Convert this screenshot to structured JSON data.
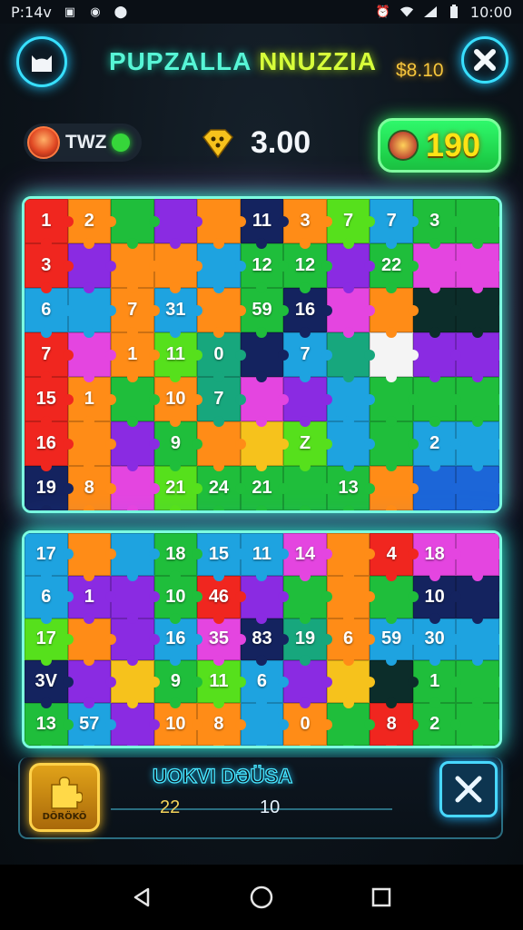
{
  "status_bar": {
    "left_text": "P:14v",
    "time": "10:00"
  },
  "header": {
    "title_part1": "PUPZALLA ",
    "title_part2": "NNUZZIA",
    "money": "$8.10"
  },
  "hud": {
    "player_name": "TWZ",
    "score": "3.00",
    "coins": "190"
  },
  "colors": {
    "red": "#f0261f",
    "orange": "#ff8c17",
    "yellow": "#f6c21c",
    "lime": "#56e01c",
    "green": "#1fbe3b",
    "teal": "#17a77d",
    "cyan": "#1ea3e0",
    "blue": "#1c66d8",
    "navy": "#14235f",
    "purple": "#8a2be2",
    "magenta": "#e445e0",
    "white": "#f4f4f4",
    "dark": "#0c2d2a"
  },
  "board_top": {
    "tiles": [
      {
        "c": "red",
        "n": "1"
      },
      {
        "c": "orange",
        "n": "2"
      },
      {
        "c": "green",
        "n": ""
      },
      {
        "c": "purple",
        "n": ""
      },
      {
        "c": "orange",
        "n": ""
      },
      {
        "c": "navy",
        "n": "11"
      },
      {
        "c": "orange",
        "n": "3"
      },
      {
        "c": "lime",
        "n": "7"
      },
      {
        "c": "cyan",
        "n": "7"
      },
      {
        "c": "green",
        "n": "3"
      },
      {
        "c": "green",
        "n": ""
      },
      {
        "c": "red",
        "n": "3"
      },
      {
        "c": "purple",
        "n": ""
      },
      {
        "c": "orange",
        "n": ""
      },
      {
        "c": "orange",
        "n": ""
      },
      {
        "c": "cyan",
        "n": ""
      },
      {
        "c": "green",
        "n": "12"
      },
      {
        "c": "green",
        "n": "12"
      },
      {
        "c": "purple",
        "n": ""
      },
      {
        "c": "green",
        "n": "22"
      },
      {
        "c": "magenta",
        "n": ""
      },
      {
        "c": "magenta",
        "n": ""
      },
      {
        "c": "cyan",
        "n": "6"
      },
      {
        "c": "cyan",
        "n": ""
      },
      {
        "c": "orange",
        "n": "7"
      },
      {
        "c": "cyan",
        "n": "31"
      },
      {
        "c": "orange",
        "n": ""
      },
      {
        "c": "green",
        "n": "59"
      },
      {
        "c": "navy",
        "n": "16"
      },
      {
        "c": "magenta",
        "n": ""
      },
      {
        "c": "orange",
        "n": ""
      },
      {
        "c": "dark",
        "n": ""
      },
      {
        "c": "dark",
        "n": ""
      },
      {
        "c": "red",
        "n": "7"
      },
      {
        "c": "magenta",
        "n": ""
      },
      {
        "c": "orange",
        "n": "1"
      },
      {
        "c": "lime",
        "n": "11"
      },
      {
        "c": "teal",
        "n": "0"
      },
      {
        "c": "navy",
        "n": ""
      },
      {
        "c": "cyan",
        "n": "7"
      },
      {
        "c": "teal",
        "n": ""
      },
      {
        "c": "white",
        "n": ""
      },
      {
        "c": "purple",
        "n": ""
      },
      {
        "c": "purple",
        "n": ""
      },
      {
        "c": "red",
        "n": "15"
      },
      {
        "c": "orange",
        "n": "1"
      },
      {
        "c": "green",
        "n": ""
      },
      {
        "c": "orange",
        "n": "10"
      },
      {
        "c": "teal",
        "n": "7"
      },
      {
        "c": "magenta",
        "n": ""
      },
      {
        "c": "purple",
        "n": ""
      },
      {
        "c": "cyan",
        "n": ""
      },
      {
        "c": "green",
        "n": ""
      },
      {
        "c": "green",
        "n": ""
      },
      {
        "c": "green",
        "n": ""
      },
      {
        "c": "red",
        "n": "16"
      },
      {
        "c": "orange",
        "n": ""
      },
      {
        "c": "purple",
        "n": ""
      },
      {
        "c": "green",
        "n": "9"
      },
      {
        "c": "orange",
        "n": ""
      },
      {
        "c": "yellow",
        "n": ""
      },
      {
        "c": "lime",
        "n": "Z"
      },
      {
        "c": "cyan",
        "n": ""
      },
      {
        "c": "green",
        "n": ""
      },
      {
        "c": "cyan",
        "n": "2"
      },
      {
        "c": "cyan",
        "n": ""
      },
      {
        "c": "navy",
        "n": "19"
      },
      {
        "c": "orange",
        "n": "8"
      },
      {
        "c": "magenta",
        "n": ""
      },
      {
        "c": "lime",
        "n": "21"
      },
      {
        "c": "green",
        "n": "24"
      },
      {
        "c": "green",
        "n": "21"
      },
      {
        "c": "green",
        "n": ""
      },
      {
        "c": "green",
        "n": "13"
      },
      {
        "c": "orange",
        "n": ""
      },
      {
        "c": "blue",
        "n": ""
      },
      {
        "c": "blue",
        "n": ""
      }
    ]
  },
  "board_bottom": {
    "tiles": [
      {
        "c": "cyan",
        "n": "17"
      },
      {
        "c": "orange",
        "n": ""
      },
      {
        "c": "cyan",
        "n": ""
      },
      {
        "c": "green",
        "n": "18"
      },
      {
        "c": "cyan",
        "n": "15"
      },
      {
        "c": "cyan",
        "n": "11"
      },
      {
        "c": "magenta",
        "n": "14"
      },
      {
        "c": "orange",
        "n": ""
      },
      {
        "c": "red",
        "n": "4"
      },
      {
        "c": "magenta",
        "n": "18"
      },
      {
        "c": "magenta",
        "n": ""
      },
      {
        "c": "cyan",
        "n": "6"
      },
      {
        "c": "purple",
        "n": "1"
      },
      {
        "c": "purple",
        "n": ""
      },
      {
        "c": "green",
        "n": "10"
      },
      {
        "c": "red",
        "n": "46"
      },
      {
        "c": "purple",
        "n": ""
      },
      {
        "c": "green",
        "n": ""
      },
      {
        "c": "orange",
        "n": ""
      },
      {
        "c": "green",
        "n": ""
      },
      {
        "c": "navy",
        "n": "10"
      },
      {
        "c": "navy",
        "n": ""
      },
      {
        "c": "lime",
        "n": "17"
      },
      {
        "c": "orange",
        "n": ""
      },
      {
        "c": "purple",
        "n": ""
      },
      {
        "c": "cyan",
        "n": "16"
      },
      {
        "c": "magenta",
        "n": "35"
      },
      {
        "c": "navy",
        "n": "83"
      },
      {
        "c": "teal",
        "n": "19"
      },
      {
        "c": "orange",
        "n": "6"
      },
      {
        "c": "cyan",
        "n": "59"
      },
      {
        "c": "cyan",
        "n": "30"
      },
      {
        "c": "cyan",
        "n": ""
      },
      {
        "c": "navy",
        "n": "3V"
      },
      {
        "c": "purple",
        "n": ""
      },
      {
        "c": "yellow",
        "n": ""
      },
      {
        "c": "green",
        "n": "9"
      },
      {
        "c": "lime",
        "n": "11"
      },
      {
        "c": "cyan",
        "n": "6"
      },
      {
        "c": "purple",
        "n": ""
      },
      {
        "c": "yellow",
        "n": ""
      },
      {
        "c": "dark",
        "n": ""
      },
      {
        "c": "green",
        "n": "1"
      },
      {
        "c": "green",
        "n": ""
      },
      {
        "c": "green",
        "n": "13"
      },
      {
        "c": "cyan",
        "n": "57"
      },
      {
        "c": "purple",
        "n": ""
      },
      {
        "c": "orange",
        "n": "10"
      },
      {
        "c": "orange",
        "n": "8"
      },
      {
        "c": "cyan",
        "n": ""
      },
      {
        "c": "orange",
        "n": "0"
      },
      {
        "c": "green",
        "n": ""
      },
      {
        "c": "red",
        "n": "8"
      },
      {
        "c": "green",
        "n": "2"
      },
      {
        "c": "green",
        "n": ""
      }
    ]
  },
  "footer": {
    "hint_label": "DÖRÖKÖ",
    "title": "UOKVI DƏÜSA",
    "num1": "22",
    "num2": "10"
  }
}
